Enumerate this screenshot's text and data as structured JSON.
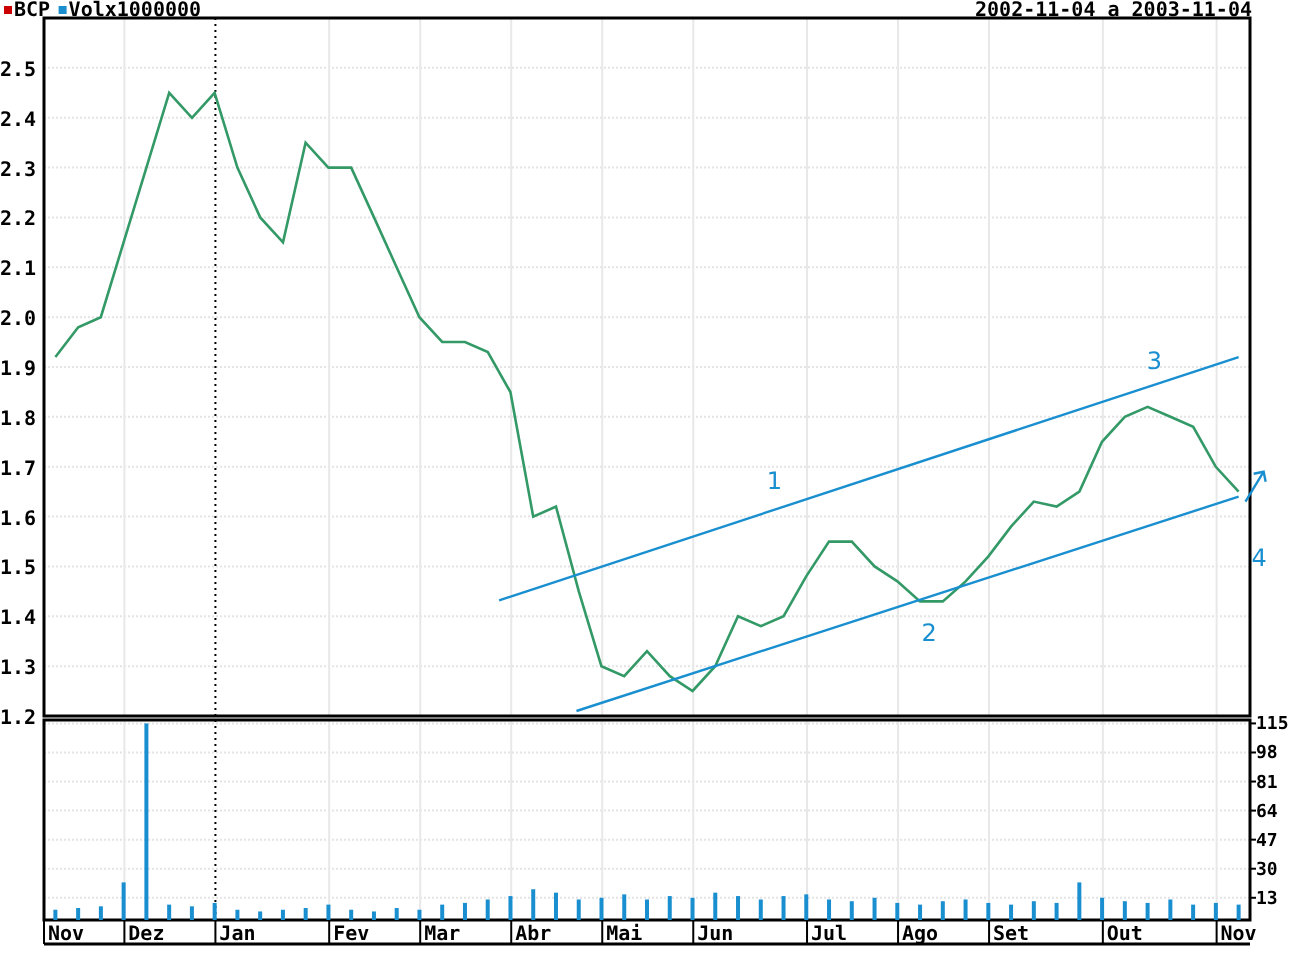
{
  "legend": [
    {
      "label": "BCP",
      "color": "#cc0000"
    },
    {
      "label": "Volx1000000",
      "color": "#1a8fd0"
    }
  ],
  "date_range": "2002-11-04 a 2003-11-04",
  "price_panel": {
    "chart_data": {
      "type": "line",
      "grid": true,
      "categories": [
        null,
        null,
        null,
        null,
        null,
        null,
        null,
        null,
        null,
        null,
        null,
        null,
        null,
        null,
        null,
        null,
        null,
        null,
        null,
        null,
        null,
        null,
        null,
        null,
        null,
        null,
        null,
        null,
        null,
        null,
        null,
        null,
        null,
        null,
        null,
        null,
        null,
        null,
        null,
        null,
        null,
        null,
        null,
        null,
        null,
        null,
        null,
        null,
        null,
        null,
        null,
        null,
        null
      ],
      "series": [
        {
          "color": "#339966",
          "values": [
            1.92,
            1.98,
            2.0,
            2.15,
            2.3,
            2.45,
            2.4,
            2.45,
            2.3,
            2.2,
            2.15,
            2.35,
            2.3,
            2.3,
            2.2,
            2.1,
            2.0,
            1.95,
            1.95,
            1.93,
            1.85,
            1.6,
            1.62,
            1.45,
            1.3,
            1.28,
            1.33,
            1.28,
            1.25,
            1.3,
            1.4,
            1.38,
            1.4,
            1.48,
            1.55,
            1.55,
            1.5,
            1.47,
            1.43,
            1.43,
            1.47,
            1.52,
            1.58,
            1.63,
            1.62,
            1.65,
            1.75,
            1.8,
            1.82,
            1.8,
            1.78,
            1.7,
            1.65
          ]
        }
      ],
      "ylim": [
        1.2,
        2.6
      ],
      "yticks": [
        {
          "value": 1.2,
          "label": "1.2"
        },
        {
          "value": 1.3,
          "label": "1.3"
        },
        {
          "value": 1.4,
          "label": "1.4"
        },
        {
          "value": 1.5,
          "label": "1.5"
        },
        {
          "value": 1.6,
          "label": "1.6"
        },
        {
          "value": 1.7,
          "label": "1.7"
        },
        {
          "value": 1.8,
          "label": "1.8"
        },
        {
          "value": 1.9,
          "label": "1.9"
        },
        {
          "value": 2.0,
          "label": "2.0"
        },
        {
          "value": 2.1,
          "label": "2.1"
        },
        {
          "value": 2.2,
          "label": "2.2"
        },
        {
          "value": 2.3,
          "label": "2.3"
        },
        {
          "value": 2.4,
          "label": "2.4"
        },
        {
          "value": 2.5,
          "label": "2.5"
        }
      ],
      "annotations": [
        "1",
        "2",
        "3",
        "4"
      ]
    }
  },
  "volume_panel": {
    "chart_data": {
      "type": "bar",
      "grid": true,
      "categories": [
        "Nov",
        null,
        null,
        null,
        "Dez",
        null,
        null,
        null,
        "Jan",
        null,
        null,
        null,
        null,
        "Fev",
        null,
        null,
        null,
        "Mar",
        null,
        null,
        null,
        "Abr",
        null,
        null,
        null,
        "Mai",
        null,
        null,
        null,
        "Jun",
        null,
        null,
        null,
        null,
        "Jul",
        null,
        null,
        null,
        "Ago",
        null,
        null,
        null,
        "Set",
        null,
        null,
        null,
        null,
        "Out",
        null,
        null,
        null,
        null,
        "Nov"
      ],
      "series": [
        {
          "color": "#1a8fd0",
          "values": [
            6,
            7,
            8,
            22,
            115,
            9,
            8,
            10,
            6,
            5,
            6,
            7,
            9,
            6,
            5,
            7,
            6,
            9,
            10,
            12,
            14,
            18,
            16,
            12,
            13,
            15,
            12,
            14,
            13,
            16,
            14,
            12,
            14,
            15,
            12,
            11,
            13,
            10,
            9,
            11,
            12,
            10,
            9,
            11,
            10,
            22,
            13,
            11,
            10,
            12,
            9,
            10,
            9
          ]
        }
      ],
      "ylim": [
        0,
        117
      ],
      "yticks": [
        13,
        30,
        47,
        64,
        81,
        98,
        115
      ]
    }
  }
}
